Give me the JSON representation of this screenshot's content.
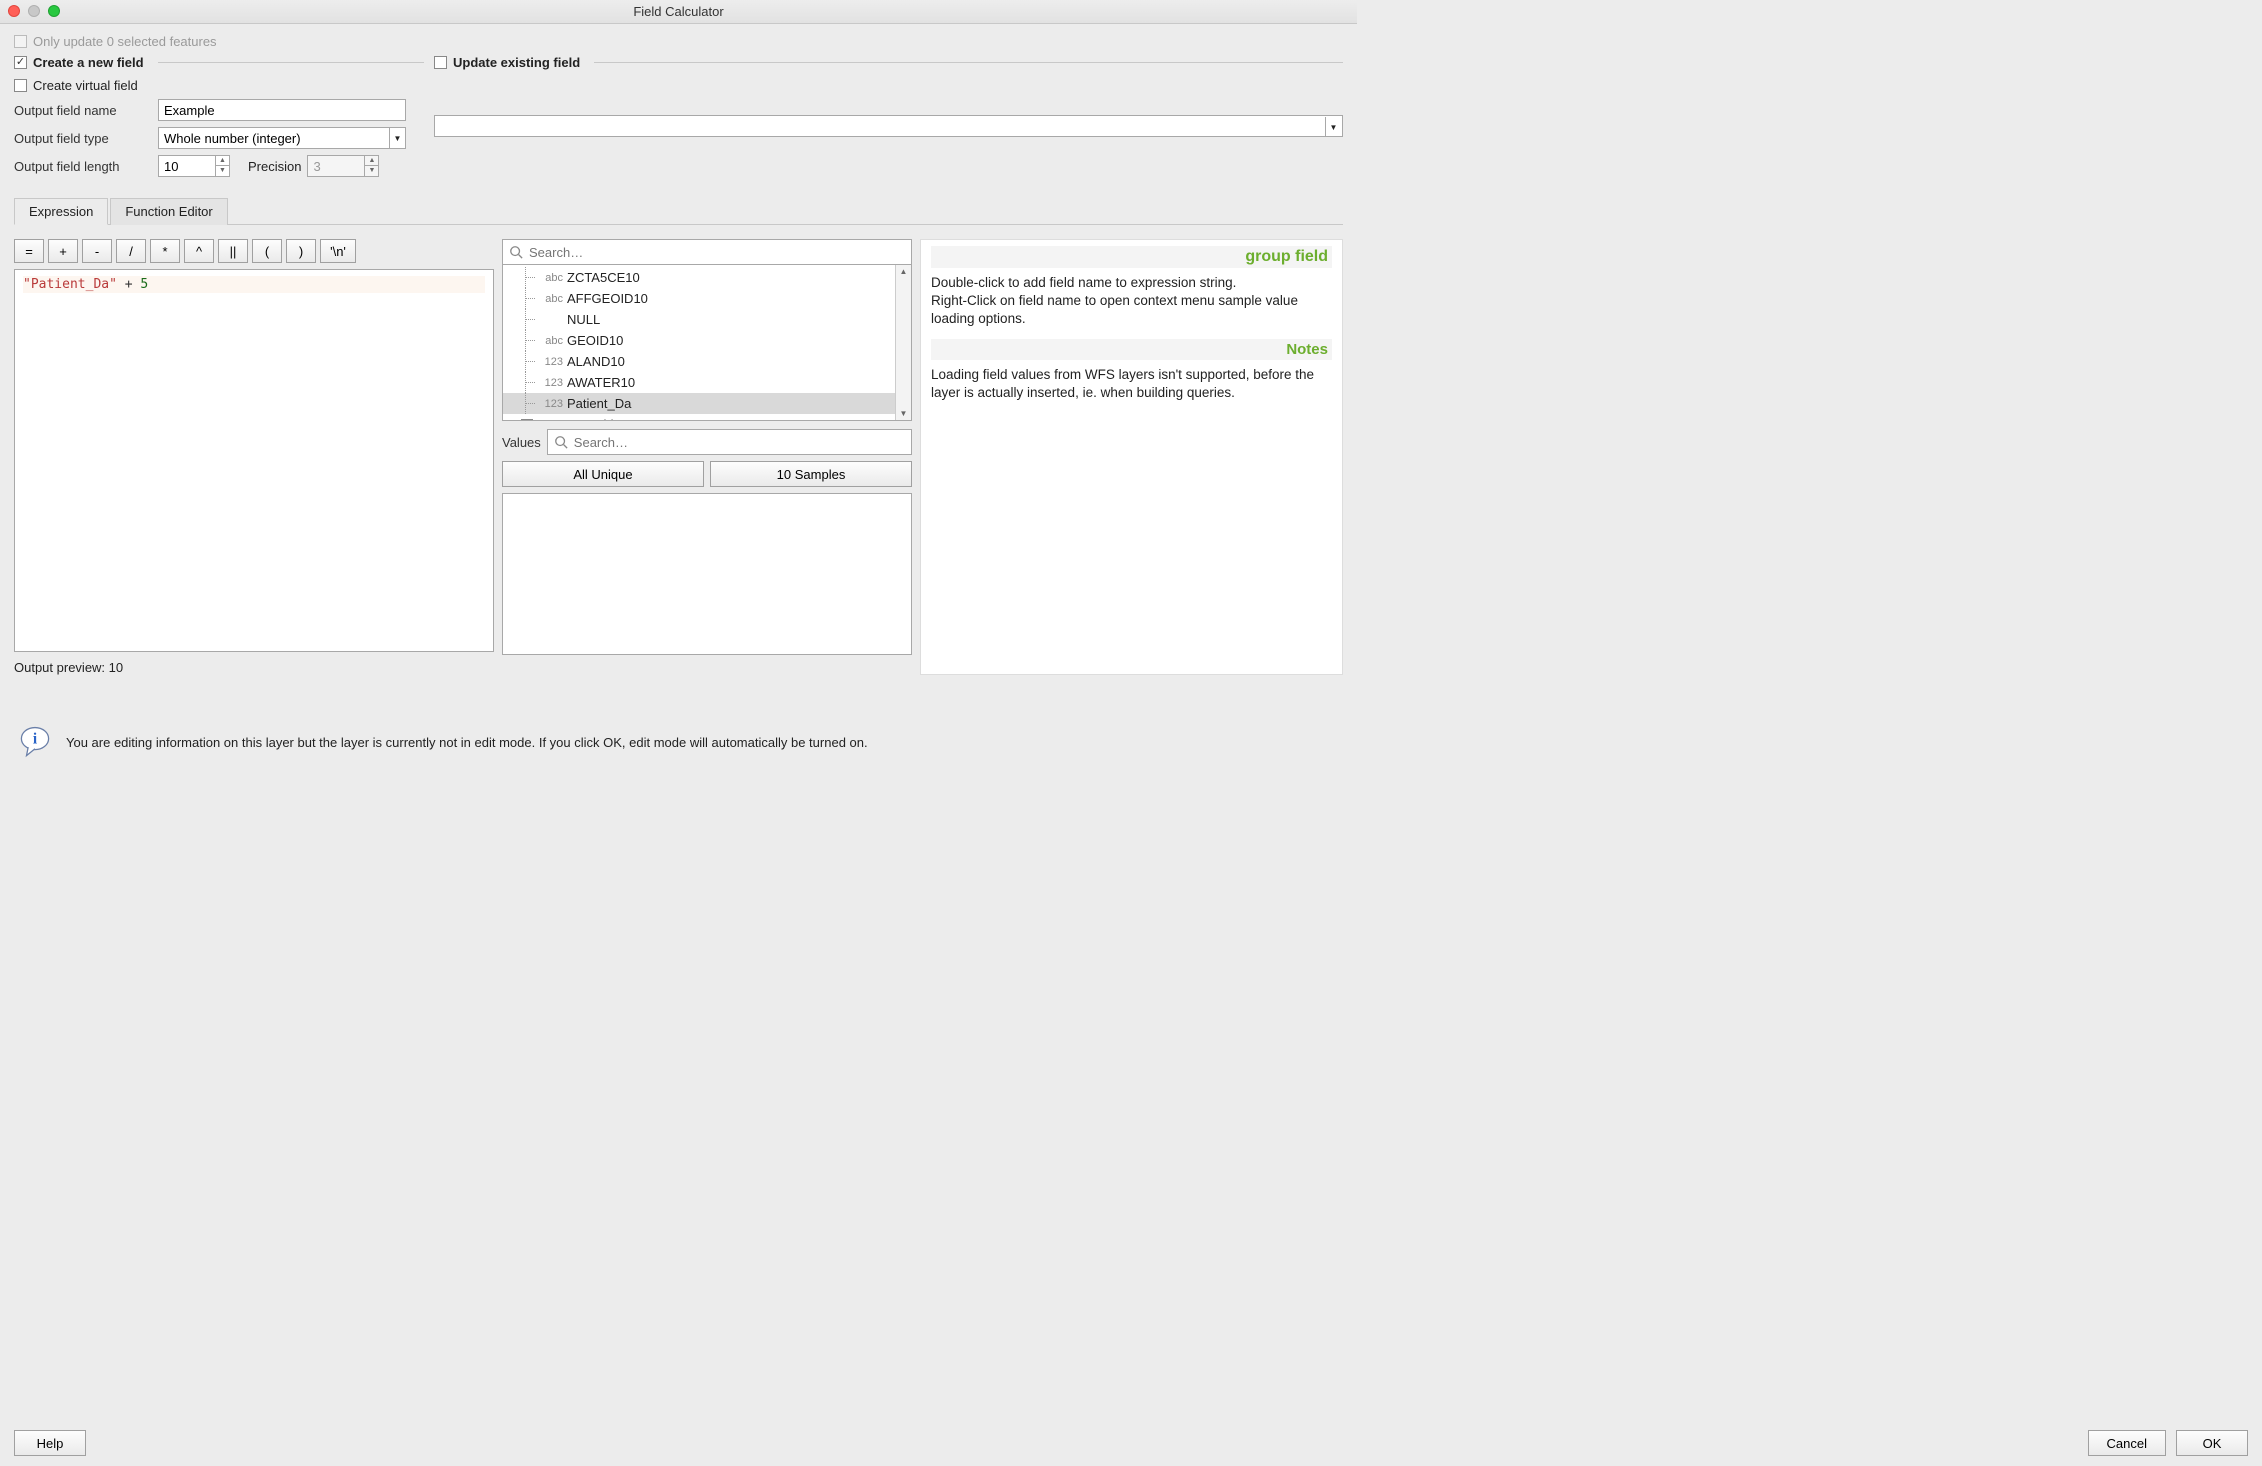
{
  "window": {
    "title": "Field Calculator"
  },
  "top": {
    "only_update_label": "Only update 0 selected features",
    "create_new_field_label": "Create a new field",
    "update_existing_label": "Update existing field"
  },
  "left_form": {
    "create_virtual_label": "Create virtual field",
    "output_name_label": "Output field name",
    "output_name_value": "Example",
    "output_type_label": "Output field type",
    "output_type_value": "Whole number (integer)",
    "output_length_label": "Output field length",
    "output_length_value": "10",
    "precision_label": "Precision",
    "precision_value": "3"
  },
  "tabs": {
    "expression": "Expression",
    "function_editor": "Function Editor"
  },
  "operators": [
    "=",
    "+",
    "-",
    "/",
    "*",
    "^",
    "||",
    "(",
    ")",
    "'\\n'"
  ],
  "expression": {
    "token1": "\"Patient_Da\"",
    "token2": " + ",
    "token3": "5"
  },
  "output_preview": {
    "label": "Output preview:",
    "value": "10"
  },
  "search": {
    "placeholder": "Search…"
  },
  "fields": [
    {
      "type": "abc",
      "name": "ZCTA5CE10"
    },
    {
      "type": "abc",
      "name": "AFFGEOID10"
    },
    {
      "type": "",
      "name": "NULL"
    },
    {
      "type": "abc",
      "name": "GEOID10"
    },
    {
      "type": "123",
      "name": "ALAND10"
    },
    {
      "type": "123",
      "name": "AWATER10"
    },
    {
      "type": "123",
      "name": "Patient_Da",
      "selected": true
    }
  ],
  "next_group": "Fuzzy Matching",
  "values": {
    "label": "Values",
    "search_placeholder": "Search…",
    "all_unique": "All Unique",
    "samples": "10 Samples"
  },
  "help": {
    "title": "group field",
    "body1": "Double-click to add field name to expression string.",
    "body2": "Right-Click on field name to open context menu sample value loading options.",
    "subtitle": "Notes",
    "notes": "Loading field values from WFS layers isn't supported, before the layer is actually inserted, ie. when building queries."
  },
  "info": {
    "text": "You are editing information on this layer but the layer is currently not in edit mode. If you click OK, edit mode will automatically be turned on."
  },
  "footer": {
    "help": "Help",
    "cancel": "Cancel",
    "ok": "OK"
  }
}
